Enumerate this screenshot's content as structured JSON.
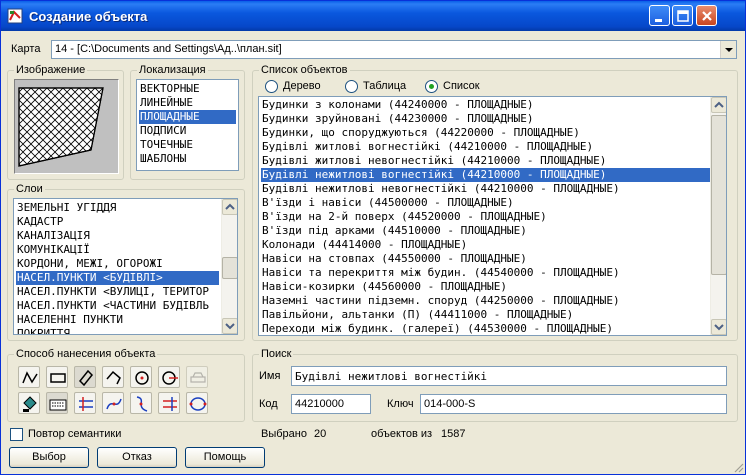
{
  "window": {
    "title": "Создание объекта"
  },
  "map": {
    "label": "Карта",
    "value": "14 - [C:\\Documents and Settings\\Ад..\\план.sit]"
  },
  "image_group": {
    "title": "Изображение"
  },
  "localization": {
    "title": "Локализация",
    "items": [
      "ВЕКТОРНЫЕ",
      "ЛИНЕЙНЫЕ",
      "ПЛОЩАДНЫЕ",
      "ПОДПИСИ",
      "ТОЧЕЧНЫЕ",
      "ШАБЛОНЫ"
    ],
    "selected_index": 2
  },
  "layers": {
    "title": "Слои",
    "items": [
      "ЗЕМЕЛЬНІ УГІДДЯ",
      "КАДАСТР",
      "КАНАЛІЗАЦІЯ",
      "КОМУНІКАЦІЇ",
      "КОРДОНИ, МЕЖІ, ОГОРОЖІ",
      "НАСЕЛ.ПУНКТИ <БУДІВЛІ>",
      "НАСЕЛ.ПУНКТИ <ВУЛИЦІ, ТЕРИТОР",
      "НАСЕЛ.ПУНКТИ <ЧАСТИНИ БУДІВЛЬ",
      "НАСЕЛЕННІ ПУНКТИ",
      "ПОКРИТТЯ"
    ],
    "selected_index": 5
  },
  "objects": {
    "title": "Список объектов",
    "view_modes": [
      "Дерево",
      "Таблица",
      "Список"
    ],
    "selected_mode": 2,
    "items": [
      "Будинки з колонами (44240000 - ПЛОЩАДНЫЕ)",
      "Будинки зруйновані (44230000 - ПЛОЩАДНЫЕ)",
      "Будинки, що споруджуються (44220000 - ПЛОЩАДНЫЕ)",
      "Будівлі житлові вогнестійкі (44210000 - ПЛОЩАДНЫЕ)",
      "Будівлі житлові невогнестійкі (44210000 - ПЛОЩАДНЫЕ)",
      "Будівлі нежитлові вогнестійкі (44210000 - ПЛОЩАДНЫЕ)",
      "Будівлі нежитлові невогнестійкі (44210000 - ПЛОЩАДНЫЕ)",
      "В'їзди і навіси (44500000 - ПЛОЩАДНЫЕ)",
      "В'їзди на 2-й поверх (44520000 - ПЛОЩАДНЫЕ)",
      "В'їзди під арками (44510000 - ПЛОЩАДНЫЕ)",
      "Колонади (44414000 - ПЛОЩАДНЫЕ)",
      "Навіси на стовпах (44550000 - ПЛОЩАДНЫЕ)",
      "Навіси та перекриття між будин. (44540000 - ПЛОЩАДНЫЕ)",
      "Навіси-козирки (44560000 - ПЛОЩАДНЫЕ)",
      "Наземні частини підземн. споруд (44250000 - ПЛОЩАДНЫЕ)",
      "Павільйони, альтанки (П) (44411000 - ПЛОЩАДНЫЕ)",
      "Переходи між будинк. (галереї) (44530000 - ПЛОЩАДНЫЕ)"
    ],
    "selected_index": 5
  },
  "drawing_method": {
    "title": "Способ нанесения объекта"
  },
  "search": {
    "title": "Поиск",
    "name_label": "Имя",
    "name_value": "Будівлі нежитлові вогнестійкі",
    "code_label": "Код",
    "code_value": "44210000",
    "key_label": "Ключ",
    "key_value": "014-000-S"
  },
  "repeat_semantics": {
    "label": "Повтор семантики",
    "checked": false
  },
  "status": {
    "selected_label": "Выбрано",
    "selected_count": "20",
    "of_label": "объектов из",
    "total": "1587"
  },
  "buttons": {
    "select": "Выбор",
    "cancel": "Отказ",
    "help": "Помощь"
  }
}
